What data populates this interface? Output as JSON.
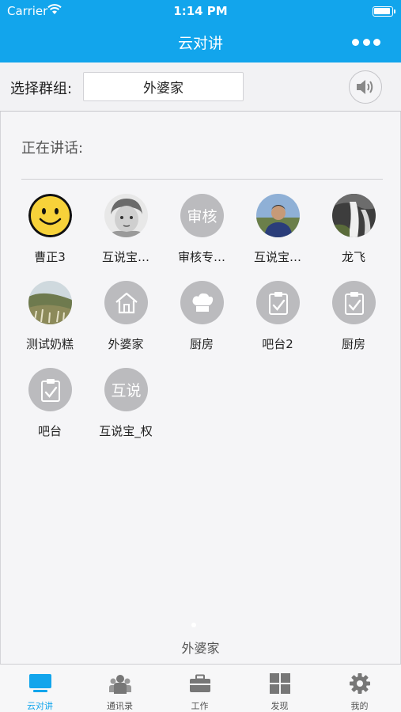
{
  "status": {
    "carrier": "Carrier",
    "time": "1:14 PM"
  },
  "nav": {
    "title": "云对讲"
  },
  "group": {
    "label": "选择群组:",
    "selected": "外婆家"
  },
  "speaking": {
    "label": "正在讲话:"
  },
  "members": [
    {
      "name": "曹正3",
      "avatar": "smiley-face-icon"
    },
    {
      "name": "互说宝…",
      "avatar": "child-photo"
    },
    {
      "name": "审核专…",
      "avatar": "text-avatar",
      "avatar_text": "审核"
    },
    {
      "name": "互说宝…",
      "avatar": "man-photo"
    },
    {
      "name": "龙飞",
      "avatar": "waterfall-photo"
    },
    {
      "name": "测试奶糕",
      "avatar": "landscape-photo"
    },
    {
      "name": "外婆家",
      "avatar": "house-icon"
    },
    {
      "name": "厨房",
      "avatar": "chef-hat-icon"
    },
    {
      "name": "吧台2",
      "avatar": "clipboard-check-icon"
    },
    {
      "name": "厨房",
      "avatar": "clipboard-check-icon"
    },
    {
      "name": "吧台",
      "avatar": "clipboard-check-icon"
    },
    {
      "name": "互说宝_权",
      "avatar": "text-avatar",
      "avatar_text": "互说"
    }
  ],
  "pager": {
    "caption": "外婆家"
  },
  "tabs": [
    {
      "label": "云对讲",
      "icon": "monitor-icon",
      "active": true
    },
    {
      "label": "通讯录",
      "icon": "contacts-icon",
      "active": false
    },
    {
      "label": "工作",
      "icon": "briefcase-icon",
      "active": false
    },
    {
      "label": "发现",
      "icon": "grid-icon",
      "active": false
    },
    {
      "label": "我的",
      "icon": "gear-icon",
      "active": false
    }
  ],
  "colors": {
    "accent": "#12a5ec",
    "avatar_gray": "#bbbbbe",
    "smiley_yellow": "#f7d23a"
  }
}
